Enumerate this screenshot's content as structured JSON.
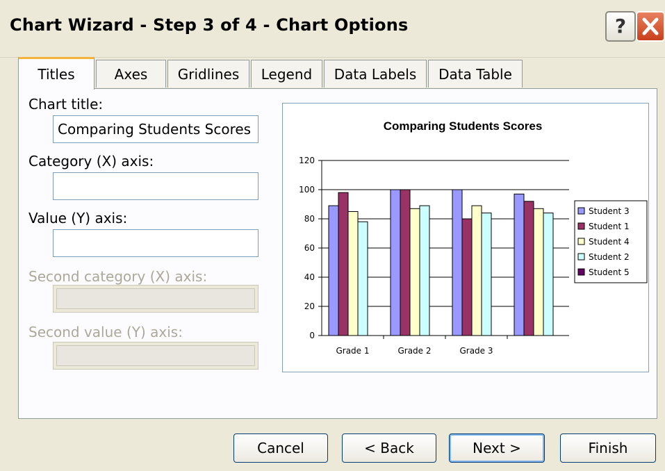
{
  "window": {
    "title": "Chart Wizard - Step 3 of 4 - Chart Options",
    "help_label": "?",
    "close_label": "✕"
  },
  "tabs": [
    {
      "label": "Titles",
      "active": true
    },
    {
      "label": "Axes",
      "active": false
    },
    {
      "label": "Gridlines",
      "active": false
    },
    {
      "label": "Legend",
      "active": false
    },
    {
      "label": "Data Labels",
      "active": false
    },
    {
      "label": "Data Table",
      "active": false
    }
  ],
  "form": {
    "chart_title_label": "Chart title:",
    "chart_title_value": "Comparing Students Scores",
    "category_x_label": "Category (X) axis:",
    "category_x_value": "",
    "value_y_label": "Value (Y) axis:",
    "value_y_value": "",
    "second_category_label": "Second category (X) axis:",
    "second_value_label": "Second value (Y) axis:"
  },
  "chart_data": {
    "type": "bar",
    "title": "Comparing Students Scores",
    "xlabel": "",
    "ylabel": "",
    "categories": [
      "Grade 1",
      "Grade 2",
      "Grade 3",
      ""
    ],
    "ylim": [
      0,
      120
    ],
    "yticks": [
      0,
      20,
      40,
      60,
      80,
      100,
      120
    ],
    "grid": true,
    "legend": "right",
    "series": [
      {
        "name": "Student 3",
        "color": "#9999ff",
        "values": [
          89,
          100,
          100,
          97
        ]
      },
      {
        "name": "Student 1",
        "color": "#993366",
        "values": [
          98,
          100,
          80,
          92
        ]
      },
      {
        "name": "Student 4",
        "color": "#ffffcc",
        "values": [
          85,
          87,
          89,
          87
        ]
      },
      {
        "name": "Student 2",
        "color": "#ccffff",
        "values": [
          78,
          89,
          84,
          84
        ]
      },
      {
        "name": "Student 5",
        "color": "#660066",
        "values": [
          null,
          null,
          null,
          null
        ]
      }
    ]
  },
  "buttons": {
    "cancel": "Cancel",
    "back": "< Back",
    "next": "Next >",
    "finish": "Finish"
  }
}
